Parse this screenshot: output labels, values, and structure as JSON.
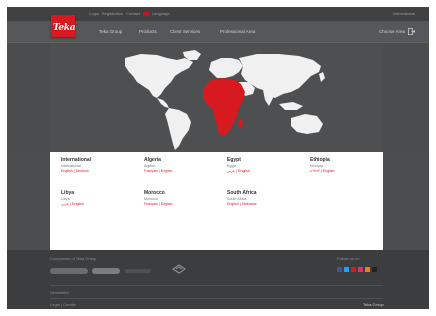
{
  "utility": {
    "links": [
      "Login",
      "Registration",
      "Contact",
      "Language"
    ],
    "right_text": "International"
  },
  "logo": {
    "text": "Teka"
  },
  "nav": {
    "items": [
      "Teka Group",
      "Products",
      "Client Services",
      "Professional Area"
    ],
    "join": "Choose Area"
  },
  "countries": [
    {
      "name": "International",
      "sub": "International",
      "langs": "English | Deutsch"
    },
    {
      "name": "Algeria",
      "sub": "Algérie",
      "langs": "Français | English"
    },
    {
      "name": "Egypt",
      "sub": "Egypt",
      "langs": "عربي | English"
    },
    {
      "name": "Ethiopia",
      "sub": "Ethiopia",
      "langs": "አማርኛ | English"
    },
    {
      "name": "Libya",
      "sub": "Libya",
      "langs": "عربي | English"
    },
    {
      "name": "Morocco",
      "sub": "Morocco",
      "langs": "Français | English"
    },
    {
      "name": "South Africa",
      "sub": "South Africa",
      "langs": "English | Afrikaans"
    }
  ],
  "footer": {
    "brands_heading": "Companies of Teka Group",
    "follow_heading": "Follow us on",
    "bottom_heading": "Newsletter",
    "legal": "Legal | Credits",
    "copyright": "Teka Group",
    "colors": {
      "accent": "#d71920",
      "footer_bg": "#3b3d3f"
    }
  }
}
